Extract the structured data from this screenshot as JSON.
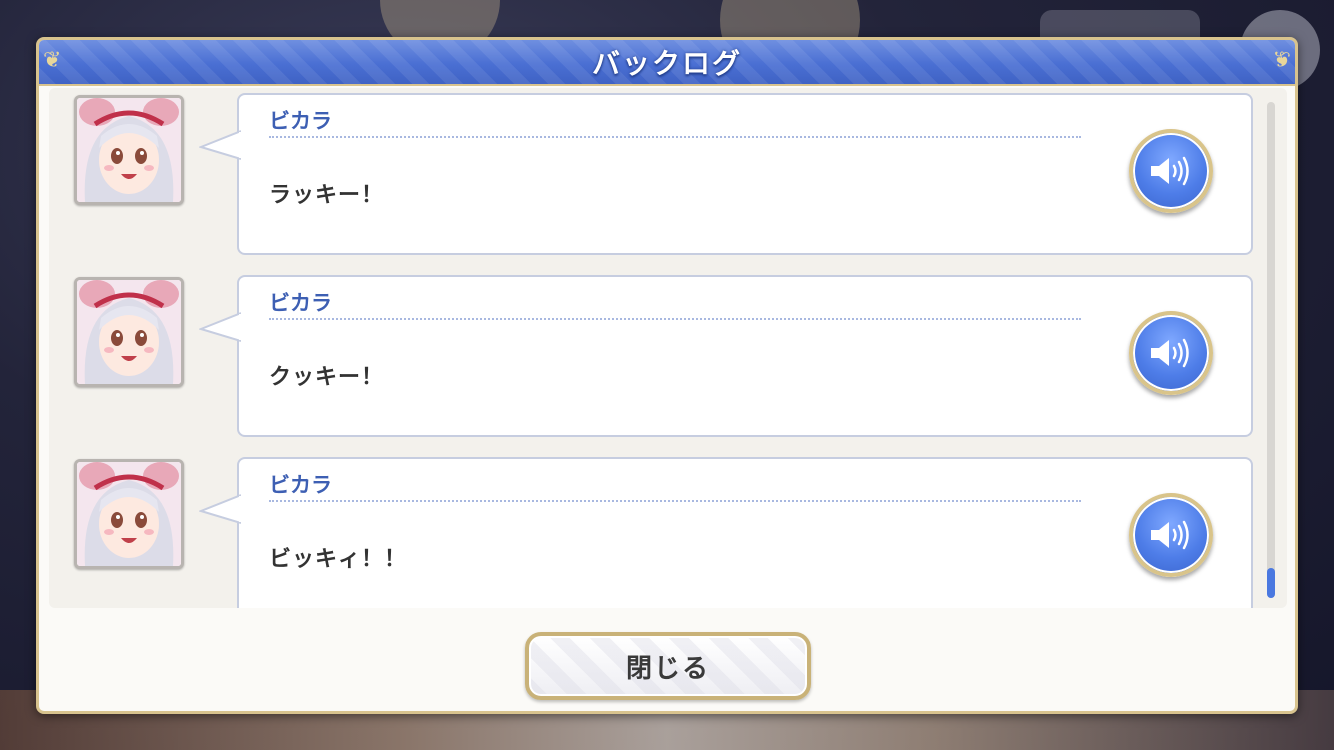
{
  "dialog": {
    "title": "バックログ"
  },
  "entries": [
    {
      "speaker": "ビカラ",
      "text": "ラッキー！",
      "icon": "speaker-volume-icon"
    },
    {
      "speaker": "ビカラ",
      "text": "クッキー！",
      "icon": "speaker-volume-icon"
    },
    {
      "speaker": "ビカラ",
      "text": "ビッキィ！！",
      "icon": "speaker-volume-icon"
    }
  ],
  "scrollbar": {
    "position": 1.0
  },
  "footer": {
    "close_label": "閉じる"
  },
  "colors": {
    "title_bar": "#4a6fd3",
    "gold_border": "#d8c38e",
    "speaker_name": "#3d5fb3",
    "voice_button": "#4e7de8"
  }
}
